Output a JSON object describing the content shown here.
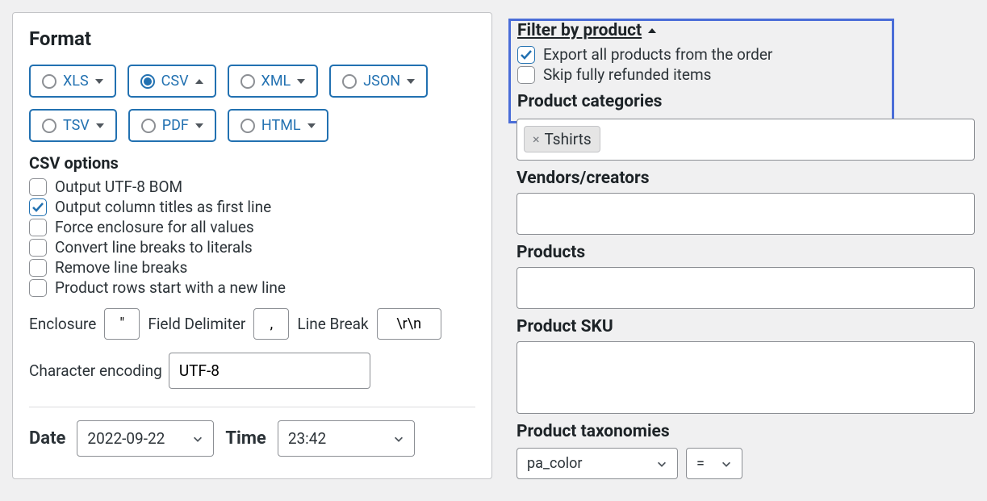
{
  "format": {
    "title": "Format",
    "options": [
      {
        "label": "XLS",
        "selected": false,
        "expanded": false
      },
      {
        "label": "CSV",
        "selected": true,
        "expanded": true
      },
      {
        "label": "XML",
        "selected": false,
        "expanded": false
      },
      {
        "label": "JSON",
        "selected": false,
        "expanded": false
      },
      {
        "label": "TSV",
        "selected": false,
        "expanded": false
      },
      {
        "label": "PDF",
        "selected": false,
        "expanded": false
      },
      {
        "label": "HTML",
        "selected": false,
        "expanded": false
      }
    ],
    "csv_options_title": "CSV options",
    "csv_checks": [
      {
        "label": "Output UTF-8 BOM",
        "checked": false
      },
      {
        "label": "Output column titles as first line",
        "checked": true
      },
      {
        "label": "Force enclosure for all values",
        "checked": false
      },
      {
        "label": "Convert line breaks to literals",
        "checked": false
      },
      {
        "label": "Remove line breaks",
        "checked": false
      },
      {
        "label": "Product rows start with a new line",
        "checked": false
      }
    ],
    "enclosure_label": "Enclosure",
    "enclosure_value": "\"",
    "delimiter_label": "Field Delimiter",
    "delimiter_value": ",",
    "linebreak_label": "Line Break",
    "linebreak_value": "\\r\\n",
    "encoding_label": "Character encoding",
    "encoding_value": "UTF-8",
    "date_label": "Date",
    "date_value": "2022-09-22",
    "time_label": "Time",
    "time_value": "23:42"
  },
  "filter": {
    "title": "Filter by product ",
    "export_all_label": "Export all products from the order",
    "export_all_checked": true,
    "skip_refunded_label": "Skip fully refunded items",
    "skip_refunded_checked": false,
    "categories_label": "Product categories",
    "categories_tags": [
      "Tshirts"
    ],
    "vendors_label": "Vendors/creators",
    "products_label": "Products",
    "sku_label": "Product SKU",
    "taxonomies_label": "Product taxonomies",
    "taxonomy_attr": "pa_color",
    "taxonomy_op": "="
  }
}
